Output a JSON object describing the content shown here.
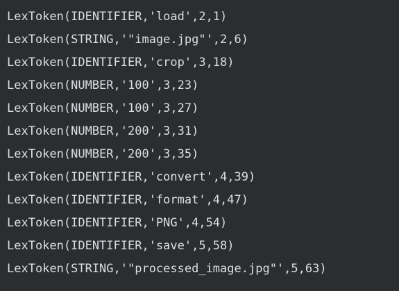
{
  "console": {
    "lines": [
      "LexToken(IDENTIFIER,'load',2,1)",
      "LexToken(STRING,'\"image.jpg\"',2,6)",
      "LexToken(IDENTIFIER,'crop',3,18)",
      "LexToken(NUMBER,'100',3,23)",
      "LexToken(NUMBER,'100',3,27)",
      "LexToken(NUMBER,'200',3,31)",
      "LexToken(NUMBER,'200',3,35)",
      "LexToken(IDENTIFIER,'convert',4,39)",
      "LexToken(IDENTIFIER,'format',4,47)",
      "LexToken(IDENTIFIER,'PNG',4,54)",
      "LexToken(IDENTIFIER,'save',5,58)",
      "LexToken(STRING,'\"processed_image.jpg\"',5,63)"
    ]
  },
  "colors": {
    "background": "#2b2d30",
    "text": "#dcdfe4"
  }
}
